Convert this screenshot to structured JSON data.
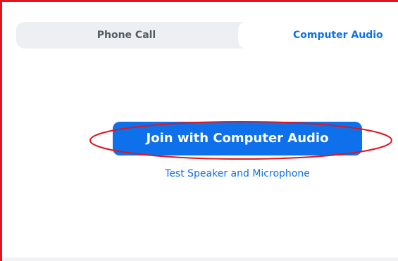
{
  "tabs": {
    "phone_label": "Phone Call",
    "computer_label": "Computer Audio",
    "selected": "Computer Audio"
  },
  "main": {
    "join_label": "Join with Computer Audio",
    "test_link_label": "Test Speaker and Microphone"
  },
  "colors": {
    "accent": "#0e71eb",
    "annotation": "#e3141d",
    "tab_bar_bg": "#eeeff3",
    "tab_inactive_text": "#555a63"
  }
}
